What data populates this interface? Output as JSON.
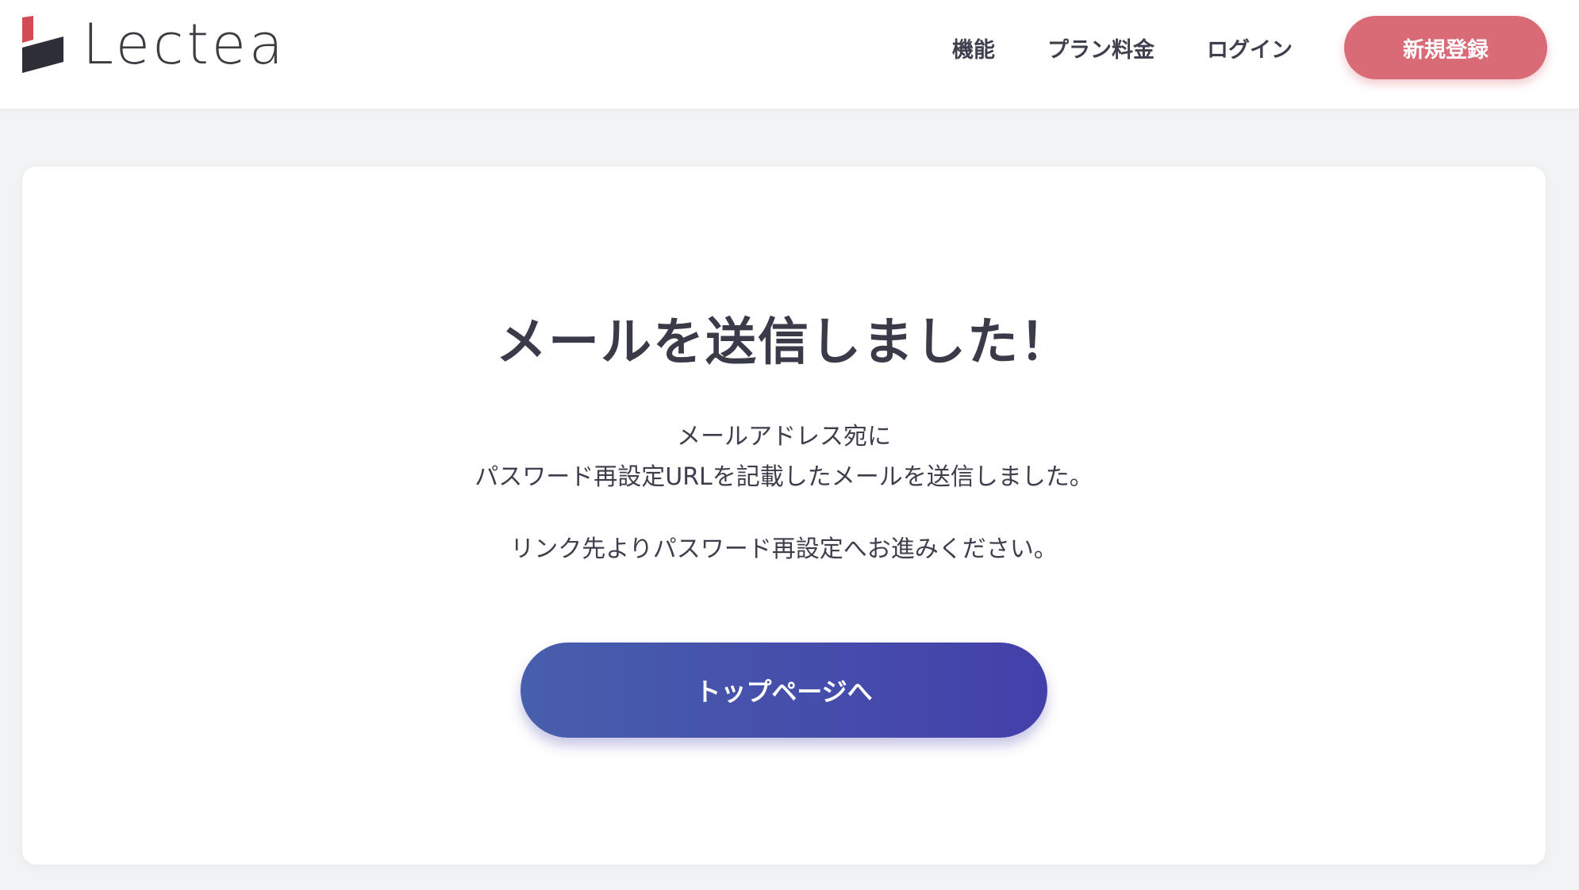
{
  "brand": {
    "name": "Lectea",
    "accent_red": "#d24a55",
    "mark_dark": "#2e2f36"
  },
  "nav": {
    "items": [
      {
        "label": "機能"
      },
      {
        "label": "プラン料金"
      },
      {
        "label": "ログイン"
      }
    ],
    "signup_label": "新規登録",
    "signup_color": "#d96b76"
  },
  "main": {
    "title": "メールを送信しました！",
    "lines": [
      "メールアドレス宛に",
      "パスワード再設定URLを記載したメールを送信しました。",
      "リンク先よりパスワード再設定へお進みください。"
    ],
    "cta_label": "トップページへ",
    "cta_colors": [
      "#475fac",
      "#4440aa"
    ]
  }
}
